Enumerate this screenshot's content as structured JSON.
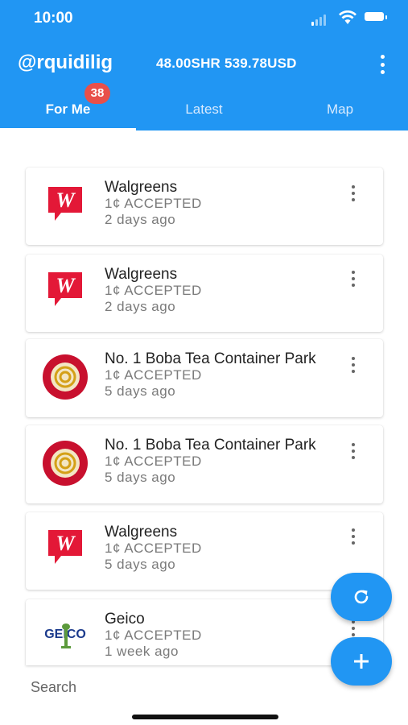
{
  "status_bar": {
    "time": "10:00"
  },
  "header": {
    "username": "@rquidilig",
    "balance": "48.00SHR 539.78USD",
    "menu_icon": "kebab-menu-icon"
  },
  "tabs": [
    {
      "label": "For Me",
      "badge": "38",
      "active": true
    },
    {
      "label": "Latest",
      "active": false
    },
    {
      "label": "Map",
      "active": false
    }
  ],
  "list": {
    "items": [
      {
        "title": "Walgreens",
        "status": "1¢ ACCEPTED",
        "time": "2 days ago",
        "logo": "walgreens-logo"
      },
      {
        "title": "Walgreens",
        "status": "1¢ ACCEPTED",
        "time": "2 days ago",
        "logo": "walgreens-logo"
      },
      {
        "title": "No. 1 Boba Tea  Container Park",
        "status": "1¢ ACCEPTED",
        "time": "5 days ago",
        "logo": "boba-tea-logo"
      },
      {
        "title": "No. 1 Boba Tea  Container Park",
        "status": "1¢ ACCEPTED",
        "time": "5 days ago",
        "logo": "boba-tea-logo"
      },
      {
        "title": "Walgreens",
        "status": "1¢ ACCEPTED",
        "time": "5 days ago",
        "logo": "walgreens-logo"
      },
      {
        "title": "Geico",
        "status": "1¢ ACCEPTED",
        "time": "1 week ago",
        "logo": "geico-logo"
      }
    ]
  },
  "search": {
    "placeholder": "Search"
  },
  "fabs": {
    "refresh_icon": "refresh-icon",
    "add_icon": "add-icon"
  },
  "colors": {
    "primary": "#2196F3",
    "badge": "#e8504a",
    "walgreens_red": "#e31837"
  }
}
